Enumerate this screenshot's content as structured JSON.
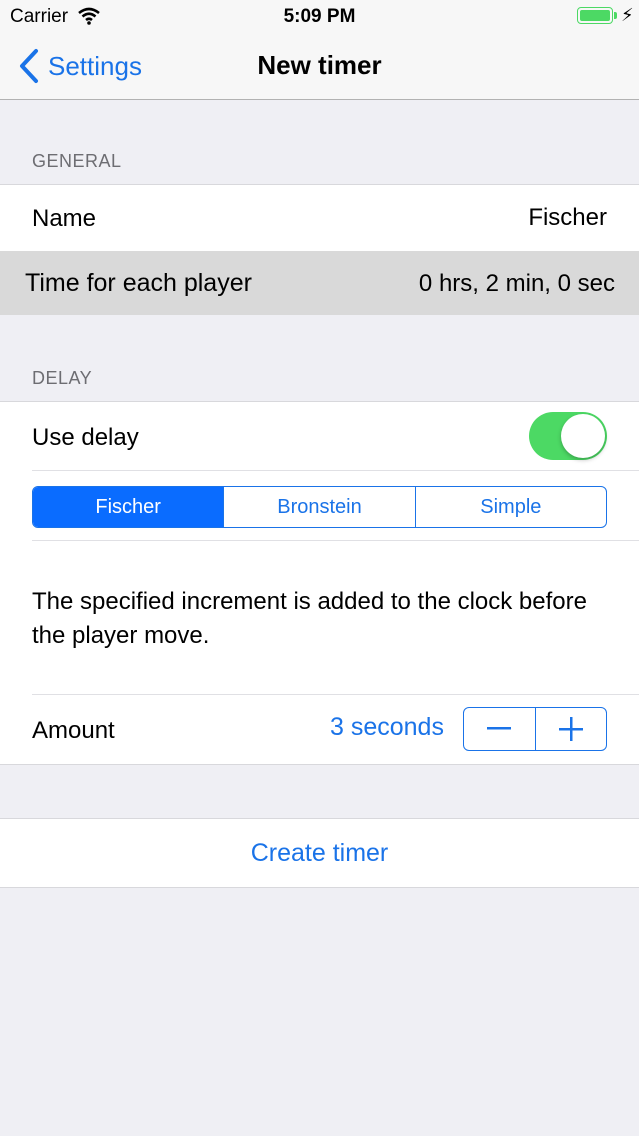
{
  "status": {
    "carrier": "Carrier",
    "time": "5:09 PM"
  },
  "nav": {
    "back_label": "Settings",
    "title": "New timer"
  },
  "sections": {
    "general": {
      "header": "GENERAL",
      "name_label": "Name",
      "name_value": "Fischer",
      "time_label": "Time for each player",
      "time_value": "0 hrs, 2 min, 0 sec"
    },
    "delay": {
      "header": "DELAY",
      "use_delay_label": "Use delay",
      "use_delay_on": true,
      "segments": [
        "Fischer",
        "Bronstein",
        "Simple"
      ],
      "selected_segment": "Fischer",
      "description": "The specified increment is added to the clock before the player move.",
      "amount_label": "Amount",
      "amount_value": "3 seconds",
      "stepper": {
        "minus": "−",
        "plus": "+"
      }
    }
  },
  "create_button": "Create timer",
  "colors": {
    "accent": "#1a73e8",
    "toggle_on": "#4cd964",
    "segment_active": "#0a6cff"
  },
  "icons": [
    "wifi-icon",
    "battery-icon",
    "charging-bolt-icon",
    "back-chevron-icon"
  ]
}
